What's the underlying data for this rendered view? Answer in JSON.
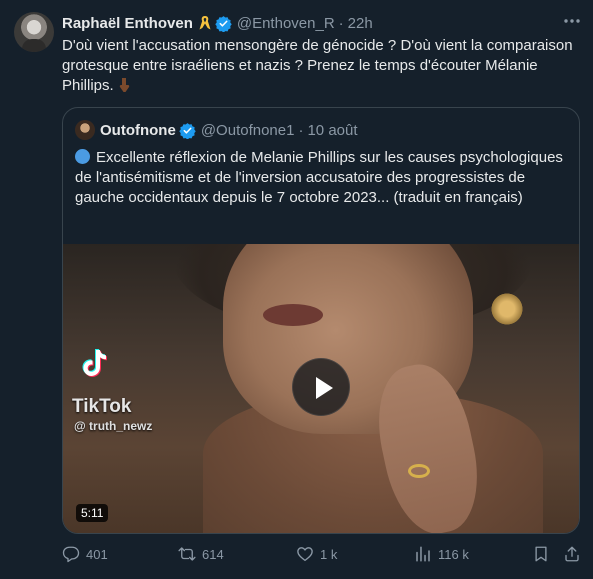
{
  "tweet": {
    "author_name": "Raphaël Enthoven",
    "handle": "@Enthoven_R",
    "separator": "·",
    "time": "22h",
    "text": "D'où vient l'accusation mensongère de génocide ? D'où vient la comparaison grotesque entre israéliens et nazis ? Prenez le temps d'écouter Mélanie Phillips."
  },
  "quote": {
    "author_name": "Outofnone",
    "handle": "@Outofnone1",
    "separator": "·",
    "time": "10 août",
    "text": "Excellente réflexion de Melanie Phillips sur les causes psychologiques de l'antisémitisme et de l'inversion accusatoire des progressistes de gauche occidentaux depuis le 7 octobre 2023... (traduit en français)",
    "video": {
      "watermark_name": "TikTok",
      "watermark_handle": "@ truth_newz",
      "duration": "5:11"
    }
  },
  "actions": {
    "replies": "401",
    "retweets": "614",
    "likes": "1 k",
    "views": "116 k"
  },
  "colors": {
    "background": "#15202b",
    "text": "#e7e9ea",
    "muted": "#8b98a5",
    "verified": "#1d9bf0",
    "border": "#38444d"
  },
  "icons": [
    "yellow-ribbon-icon",
    "verified-badge-icon",
    "more-icon",
    "pointing-down-emoji-icon",
    "globe-icon",
    "tiktok-logo-icon",
    "play-icon",
    "reply-icon",
    "retweet-icon",
    "like-icon",
    "views-icon",
    "bookmark-icon",
    "share-icon"
  ]
}
